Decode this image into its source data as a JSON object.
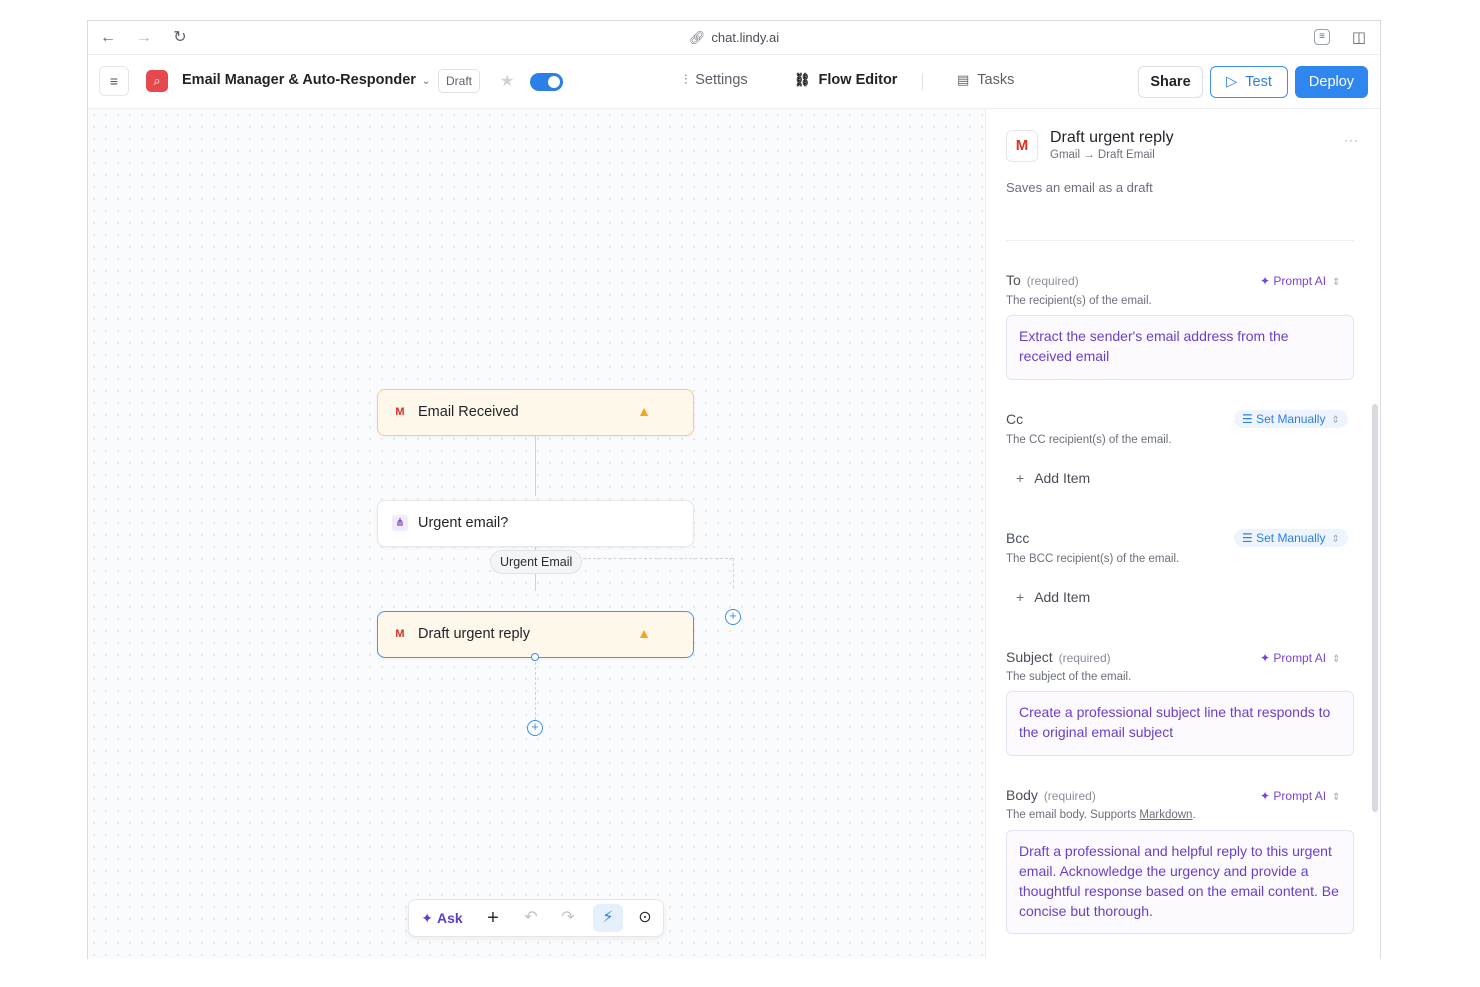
{
  "browser": {
    "url": "chat.lindy.ai"
  },
  "header": {
    "app_name": "Email Manager & Auto-Responder",
    "status_badge": "Draft",
    "toggle_on": true,
    "tabs": [
      {
        "label": "Settings",
        "active": false
      },
      {
        "label": "Flow Editor",
        "active": true
      },
      {
        "label": "Tasks",
        "active": false
      }
    ],
    "share_label": "Share",
    "test_label": "Test",
    "deploy_label": "Deploy"
  },
  "flow": {
    "nodes": [
      {
        "label": "Email Received",
        "icon": "gmail-trigger-icon",
        "warning": true
      },
      {
        "label": "Urgent email?",
        "icon": "condition-icon",
        "warning": false
      },
      {
        "label": "Draft urgent reply",
        "icon": "gmail-icon",
        "warning": true,
        "selected": true
      }
    ],
    "edge_label": "Urgent Email"
  },
  "toolbar": {
    "ask_label": "Ask"
  },
  "panel": {
    "title": "Draft urgent reply",
    "subtitle": "Gmail → Draft Email",
    "description": "Saves an email as a draft",
    "fields": {
      "to": {
        "label": "To",
        "required": "(required)",
        "hint": "The recipient(s) of the email.",
        "mode": "Prompt AI",
        "value": "Extract the sender's email address from the received email"
      },
      "cc": {
        "label": "Cc",
        "hint": "The CC recipient(s) of the email.",
        "mode": "Set Manually",
        "add_label": "Add Item"
      },
      "bcc": {
        "label": "Bcc",
        "hint": "The BCC recipient(s) of the email.",
        "mode": "Set Manually",
        "add_label": "Add Item"
      },
      "subject": {
        "label": "Subject",
        "required": "(required)",
        "hint": "The subject of the email.",
        "mode": "Prompt AI",
        "value": "Create a professional subject line that responds to the original email subject"
      },
      "body": {
        "label": "Body",
        "required": "(required)",
        "hint_prefix": "The email body. Supports ",
        "hint_link": "Markdown",
        "hint_suffix": ".",
        "mode": "Prompt AI",
        "value": "Draft a professional and helpful reply to this urgent email. Acknowledge the urgency and provide a thoughtful response based on the email content. Be concise but thorough."
      }
    }
  },
  "colors": {
    "accent": "#2f86ee",
    "warning": "#f5a524",
    "ai_purple": "#6a3fc7",
    "app_logo": "#e5484d"
  }
}
